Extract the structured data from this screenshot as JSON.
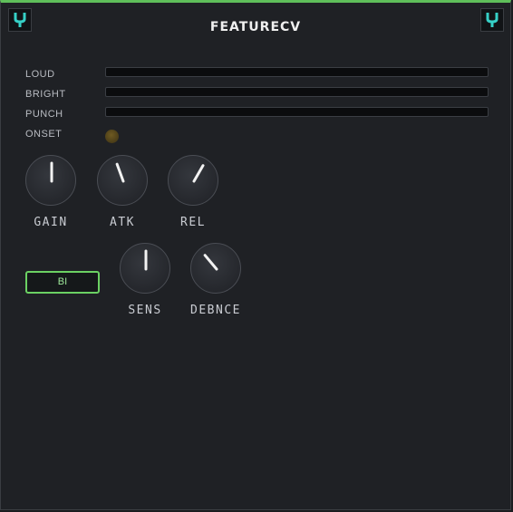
{
  "module": {
    "title": "FEATURECV",
    "accent_color": "#5fbf5a",
    "logo_icon": "tuning-fork-icon"
  },
  "meters": [
    {
      "label": "LOUD",
      "level": 0
    },
    {
      "label": "BRIGHT",
      "level": 0
    },
    {
      "label": "PUNCH",
      "level": 0
    }
  ],
  "onset": {
    "label": "ONSET",
    "active": false
  },
  "knobs": [
    {
      "label": "GAIN",
      "angle_deg": 0
    },
    {
      "label": "ATK",
      "angle_deg": -20
    },
    {
      "label": "REL",
      "angle_deg": 30
    },
    {
      "label": "SENS",
      "angle_deg": 0
    },
    {
      "label": "DEBNCE",
      "angle_deg": -40
    }
  ],
  "bi_button": {
    "label": "BI",
    "active": true
  }
}
